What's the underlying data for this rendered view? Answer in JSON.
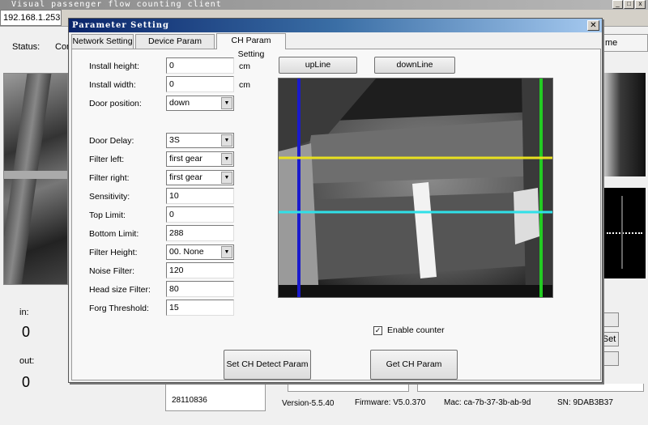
{
  "app": {
    "title": "Visual passenger flow counting client",
    "ip": "192.168.1.253",
    "status_label": "Status:",
    "status_value_partial": "Con",
    "right_header_partial": "me",
    "in_label": "in:",
    "in_value": "0",
    "out_label": "out:",
    "out_value": "0",
    "right_button_partial": "Set",
    "serial": "28110836",
    "version": "Version-5.5.40",
    "firmware": "Firmware: V5.0.370",
    "mac": "Mac: ca-7b-37-3b-ab-9d",
    "sn": "SN: 9DAB3B37"
  },
  "dialog": {
    "title": "Parameter Setting",
    "close": "✕",
    "tabs": [
      {
        "label": "Network Setting"
      },
      {
        "label": "Device Param Setting"
      },
      {
        "label": "CH Param Setting"
      }
    ],
    "fields": {
      "install_height": {
        "label": "Install height:",
        "value": "0",
        "unit": "cm"
      },
      "install_width": {
        "label": "Install width:",
        "value": "0",
        "unit": "cm"
      },
      "door_position": {
        "label": "Door position:",
        "value": "down"
      },
      "door_delay": {
        "label": "Door Delay:",
        "value": "3S"
      },
      "filter_left": {
        "label": "Filter left:",
        "value": "first gear"
      },
      "filter_right": {
        "label": "Filter right:",
        "value": "first gear"
      },
      "sensitivity": {
        "label": "Sensitivity:",
        "value": "10"
      },
      "top_limit": {
        "label": "Top Limit:",
        "value": "0"
      },
      "bottom_limit": {
        "label": "Bottom Limit:",
        "value": "288"
      },
      "filter_height": {
        "label": "Filter Height:",
        "value": "00. None"
      },
      "noise_filter": {
        "label": "Noise Filter:",
        "value": "120"
      },
      "head_size_filter": {
        "label": "Head size Filter:",
        "value": "80"
      },
      "forg_threshold": {
        "label": "Forg Threshold:",
        "value": "15"
      }
    },
    "upline_button": "upLine",
    "downline_button": "downLine",
    "enable_counter_label": "Enable counter",
    "enable_counter_checked": true,
    "set_button": "Set CH Detect Param",
    "get_button": "Get CH Param"
  },
  "colors": {
    "line_blue": "#1a1acc",
    "line_green": "#22cc22",
    "line_yellow": "#e8e020",
    "line_cyan": "#30e0e8"
  }
}
